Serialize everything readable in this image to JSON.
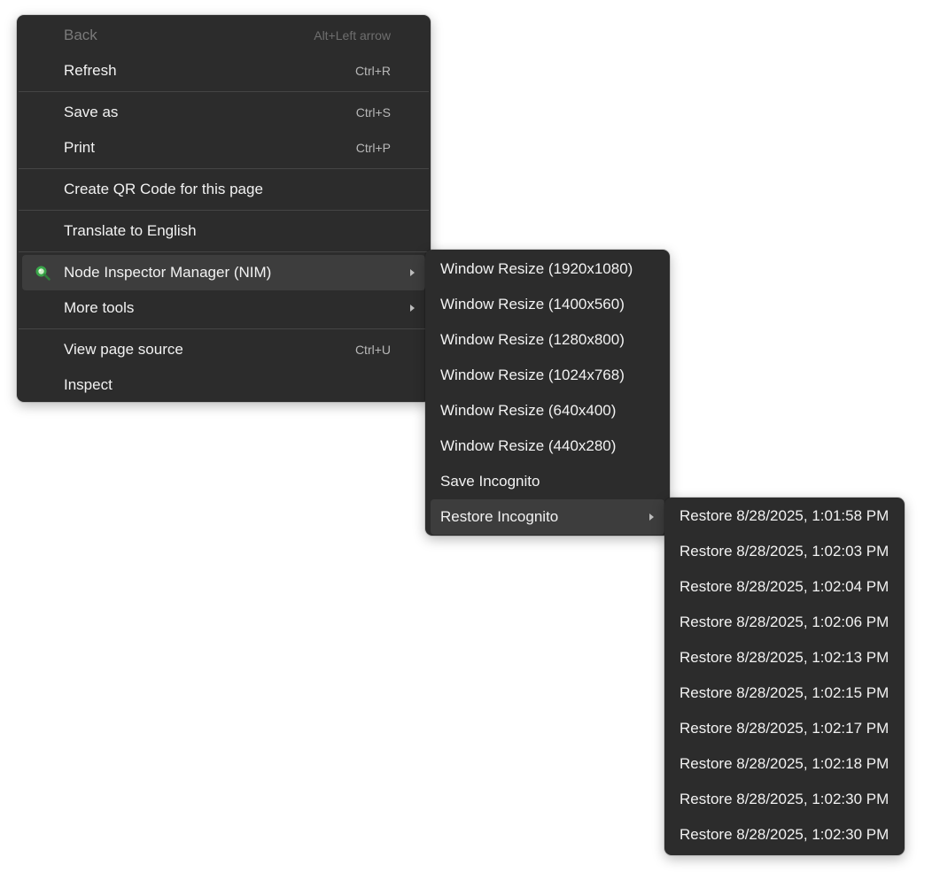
{
  "main_menu": {
    "back": {
      "label": "Back",
      "shortcut": "Alt+Left arrow"
    },
    "refresh": {
      "label": "Refresh",
      "shortcut": "Ctrl+R"
    },
    "save_as": {
      "label": "Save as",
      "shortcut": "Ctrl+S"
    },
    "print": {
      "label": "Print",
      "shortcut": "Ctrl+P"
    },
    "qr_code": {
      "label": "Create QR Code for this page"
    },
    "translate": {
      "label": "Translate to English"
    },
    "nim": {
      "label": "Node Inspector Manager (NIM)",
      "icon": "nim-extension-icon"
    },
    "more_tools": {
      "label": "More tools"
    },
    "view_source": {
      "label": "View page source",
      "shortcut": "Ctrl+U"
    },
    "inspect": {
      "label": "Inspect"
    }
  },
  "nim_submenu": {
    "items": [
      "Window Resize (1920x1080)",
      "Window Resize (1400x560)",
      "Window Resize (1280x800)",
      "Window Resize (1024x768)",
      "Window Resize (640x400)",
      "Window Resize (440x280)",
      "Save Incognito",
      "Restore Incognito"
    ]
  },
  "restore_submenu": {
    "items": [
      "Restore 8/28/2025, 1:01:58 PM",
      "Restore 8/28/2025, 1:02:03 PM",
      "Restore 8/28/2025, 1:02:04 PM",
      "Restore 8/28/2025, 1:02:06 PM",
      "Restore 8/28/2025, 1:02:13 PM",
      "Restore 8/28/2025, 1:02:15 PM",
      "Restore 8/28/2025, 1:02:17 PM",
      "Restore 8/28/2025, 1:02:18 PM",
      "Restore 8/28/2025, 1:02:30 PM",
      "Restore 8/28/2025, 1:02:30 PM"
    ]
  },
  "colors": {
    "menu_bg": "#2c2c2c",
    "highlight_bg": "#3d3d3d",
    "text": "#f2f2f2",
    "disabled_text": "#7a7a7a",
    "nim_icon_green": "#3aa64a"
  }
}
